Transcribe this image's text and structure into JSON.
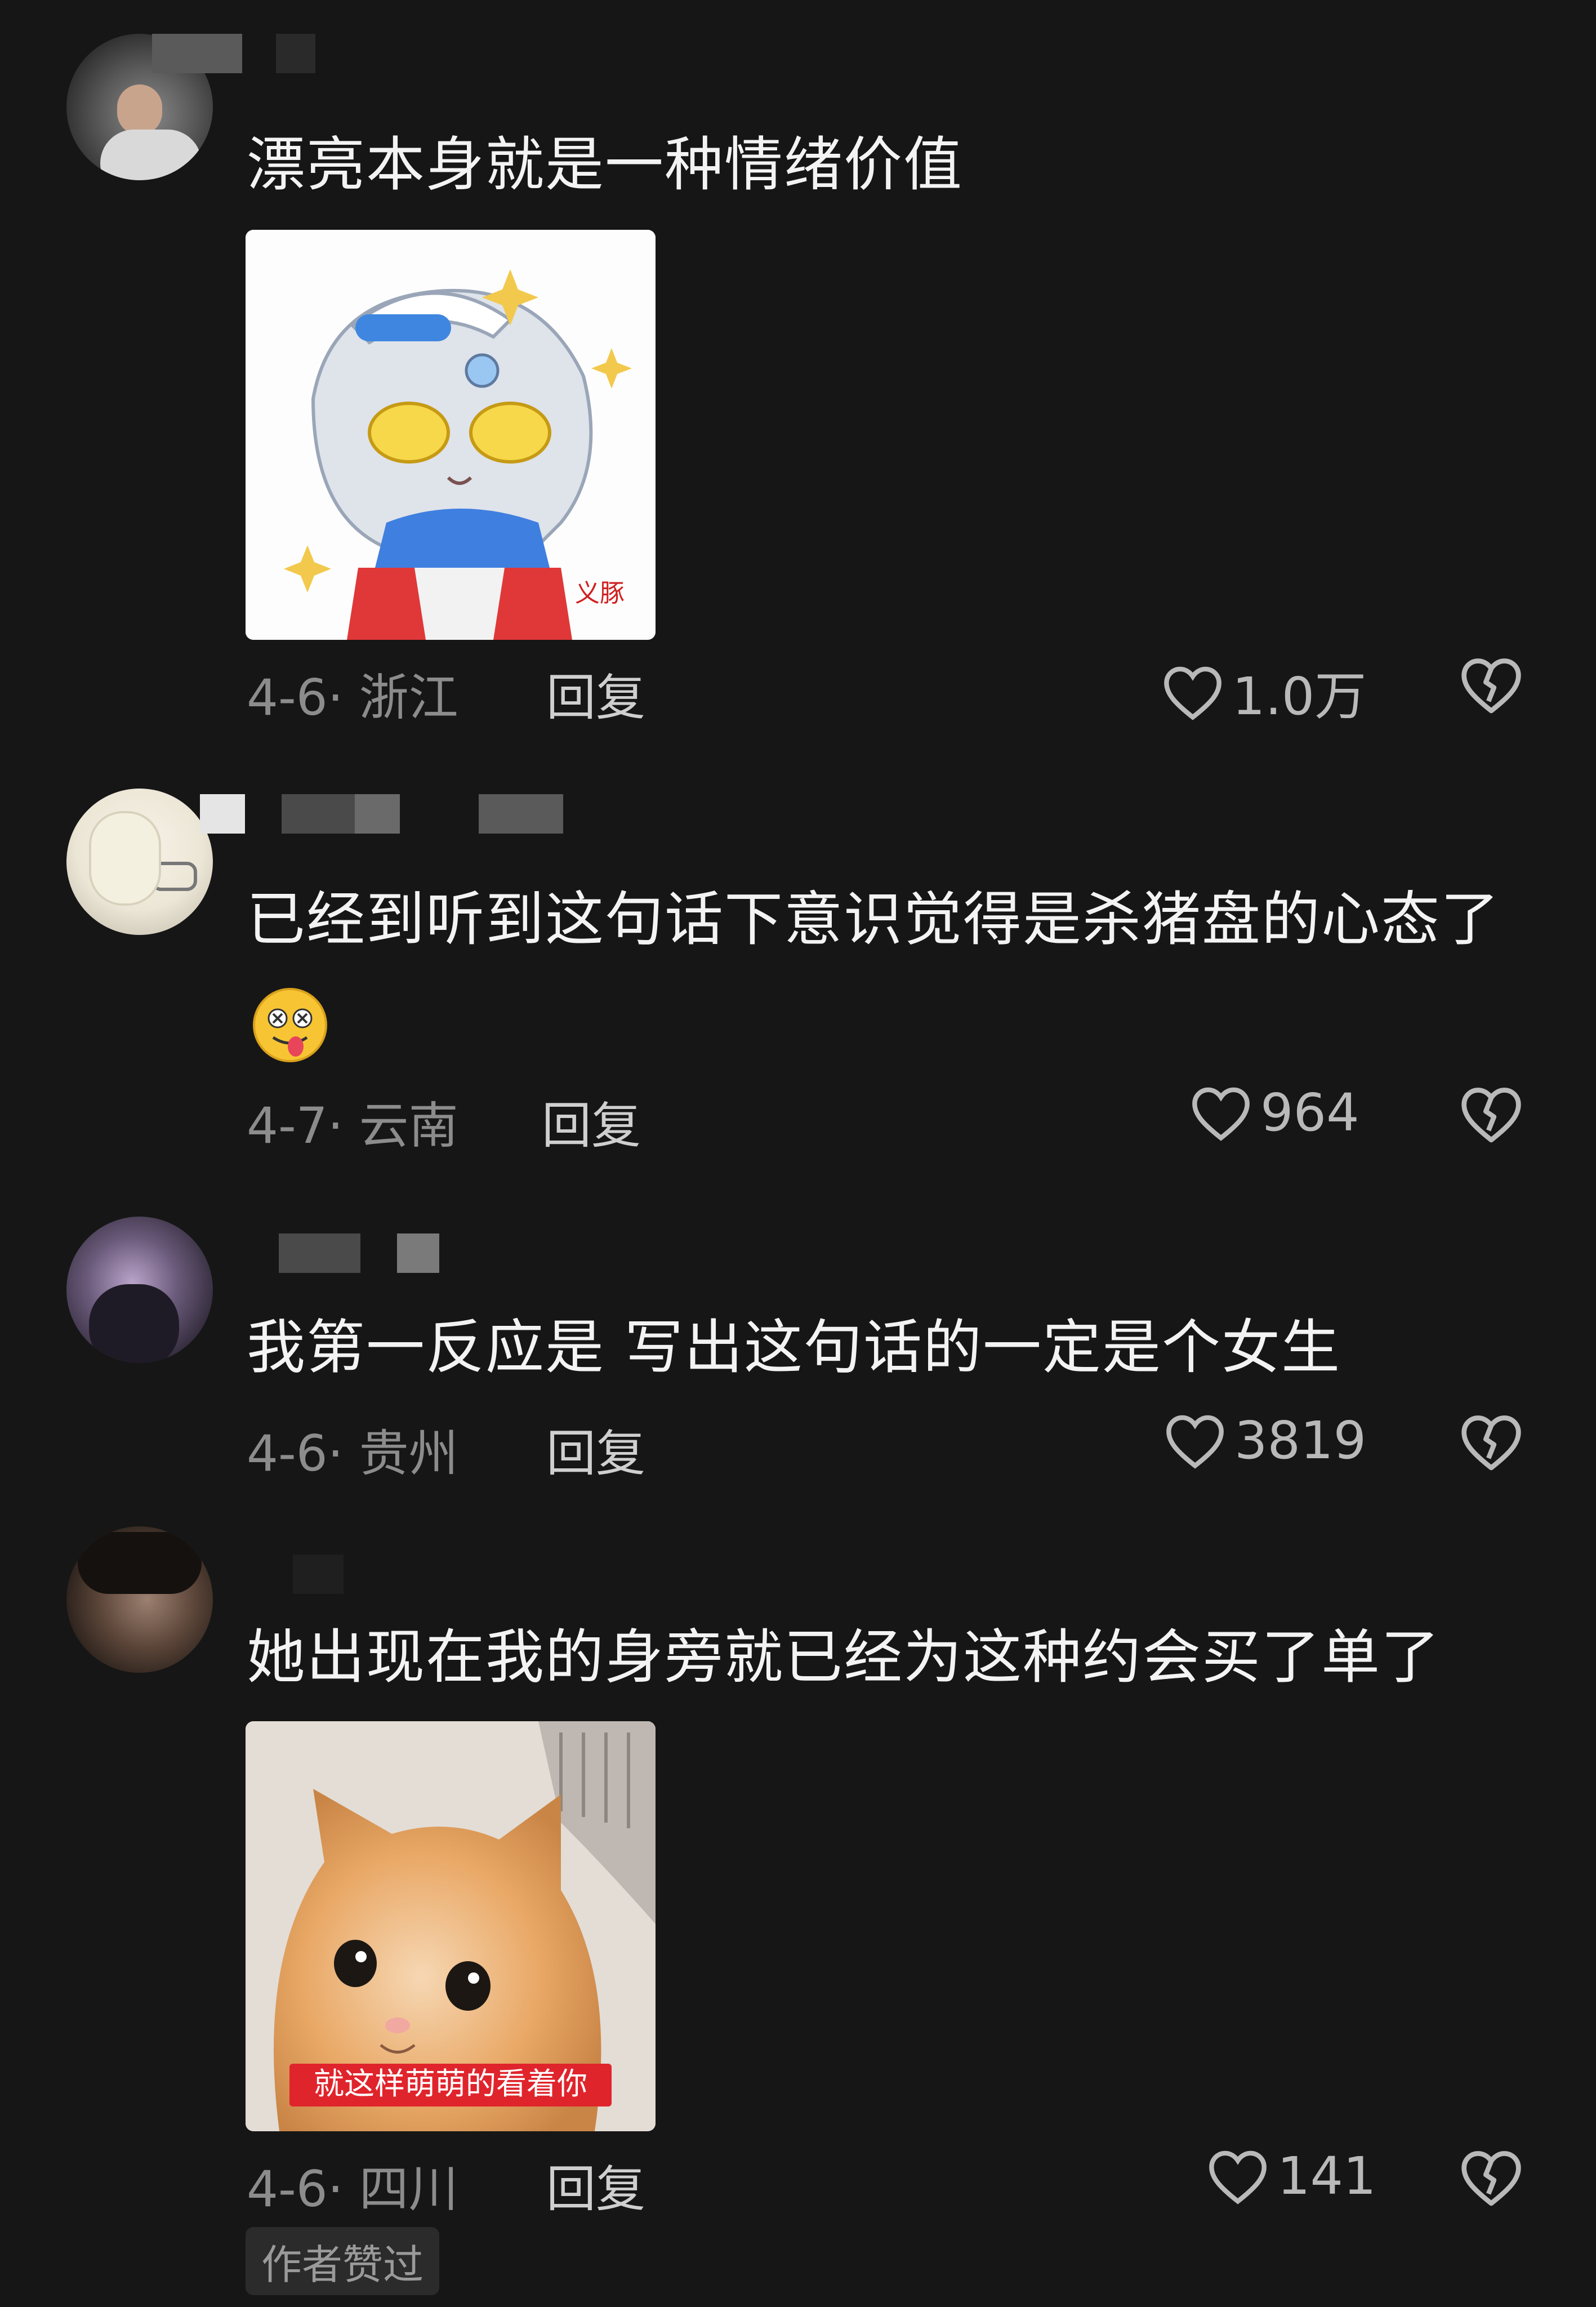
{
  "comments": [
    {
      "text": "漂亮本身就是一种情绪价值",
      "date_location": "4-6· 浙江",
      "reply_label": "回复",
      "likes": "1.0万",
      "media_type": "sticker"
    },
    {
      "text_line1": "已经到听到这句话下意识觉得是杀猪盘的心态了",
      "date_location": "4-7· 云南",
      "reply_label": "回复",
      "likes": "964",
      "emoji": "dizzy-tongue-face-emoji"
    },
    {
      "text": "我第一反应是 写出这句话的一定是个女生",
      "date_location": "4-6· 贵州",
      "reply_label": "回复",
      "likes": "3819"
    },
    {
      "text": "她出现在我的身旁就已经为这种约会买了单了",
      "date_location": "4-6· 四川",
      "reply_label": "回复",
      "likes": "141",
      "media_caption": "就这样萌萌的看着你",
      "author_badge": "作者赞过",
      "media_type": "kitten-photo"
    }
  ],
  "icons": {
    "like": "heart-outline-icon",
    "dislike": "broken-heart-icon"
  },
  "colors": {
    "background": "#161616",
    "text": "#f3f3f3",
    "meta": "#8c8c8c",
    "caption_bg": "#e0242c"
  }
}
